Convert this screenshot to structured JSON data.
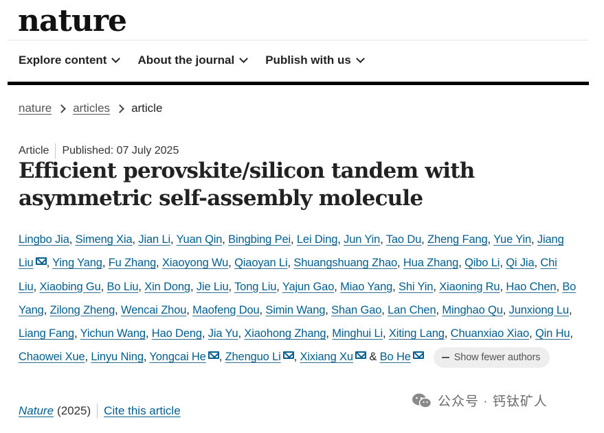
{
  "site": {
    "logo": "nature"
  },
  "nav": {
    "items": [
      {
        "label": "Explore content"
      },
      {
        "label": "About the journal"
      },
      {
        "label": "Publish with us"
      }
    ]
  },
  "breadcrumb": {
    "items": [
      {
        "label": "nature"
      },
      {
        "label": "articles"
      }
    ],
    "current": "article"
  },
  "article": {
    "type": "Article",
    "published": "Published: 07 July 2025",
    "title": "Efficient perovskite/silicon tandem with asymmetric self-assembly molecule",
    "authors": [
      {
        "name": "Lingbo Jia",
        "mail": false
      },
      {
        "name": "Simeng Xia",
        "mail": false
      },
      {
        "name": "Jian Li",
        "mail": false
      },
      {
        "name": "Yuan Qin",
        "mail": false
      },
      {
        "name": "Bingbing Pei",
        "mail": false
      },
      {
        "name": "Lei Ding",
        "mail": false
      },
      {
        "name": "Jun Yin",
        "mail": false
      },
      {
        "name": "Tao Du",
        "mail": false
      },
      {
        "name": "Zheng Fang",
        "mail": false
      },
      {
        "name": "Yue Yin",
        "mail": false
      },
      {
        "name": "Jiang Liu",
        "mail": true
      },
      {
        "name": "Ying Yang",
        "mail": false
      },
      {
        "name": "Fu Zhang",
        "mail": false
      },
      {
        "name": "Xiaoyong Wu",
        "mail": false
      },
      {
        "name": "Qiaoyan Li",
        "mail": false
      },
      {
        "name": "Shuangshuang Zhao",
        "mail": false
      },
      {
        "name": "Hua Zhang",
        "mail": false
      },
      {
        "name": "Qibo Li",
        "mail": false
      },
      {
        "name": "Qi Jia",
        "mail": false
      },
      {
        "name": "Chi Liu",
        "mail": false
      },
      {
        "name": "Xiaobing Gu",
        "mail": false
      },
      {
        "name": "Bo Liu",
        "mail": false
      },
      {
        "name": "Xin Dong",
        "mail": false
      },
      {
        "name": "Jie Liu",
        "mail": false
      },
      {
        "name": "Tong Liu",
        "mail": false
      },
      {
        "name": "Yajun Gao",
        "mail": false
      },
      {
        "name": "Miao Yang",
        "mail": false
      },
      {
        "name": "Shi Yin",
        "mail": false
      },
      {
        "name": "Xiaoning Ru",
        "mail": false
      },
      {
        "name": "Hao Chen",
        "mail": false
      },
      {
        "name": "Bo Yang",
        "mail": false
      },
      {
        "name": "Zilong Zheng",
        "mail": false
      },
      {
        "name": "Wencai Zhou",
        "mail": false
      },
      {
        "name": "Maofeng Dou",
        "mail": false
      },
      {
        "name": "Simin Wang",
        "mail": false
      },
      {
        "name": "Shan Gao",
        "mail": false
      },
      {
        "name": "Lan Chen",
        "mail": false
      },
      {
        "name": "Minghao Qu",
        "mail": false
      },
      {
        "name": "Junxiong Lu",
        "mail": false
      },
      {
        "name": "Liang Fang",
        "mail": false
      },
      {
        "name": "Yichun Wang",
        "mail": false
      },
      {
        "name": "Hao Deng",
        "mail": false
      },
      {
        "name": "Jia Yu",
        "mail": false
      },
      {
        "name": "Xiaohong Zhang",
        "mail": false
      },
      {
        "name": "Minghui Li",
        "mail": false
      },
      {
        "name": "Xiting Lang",
        "mail": false
      },
      {
        "name": "Chuanxiao Xiao",
        "mail": false
      },
      {
        "name": "Qin Hu",
        "mail": false
      },
      {
        "name": "Chaowei Xue",
        "mail": false
      },
      {
        "name": "Linyu Ning",
        "mail": false
      },
      {
        "name": "Yongcai He",
        "mail": true
      },
      {
        "name": "Zhenguo Li",
        "mail": true
      },
      {
        "name": "Xixiang Xu",
        "mail": true
      },
      {
        "name": "Bo He",
        "mail": true
      }
    ],
    "show_fewer_label": "Show fewer authors",
    "journal": "Nature",
    "year": "(2025)",
    "cite_label": "Cite this article"
  },
  "watermark": {
    "text": "公众号 · 钙钛矿人",
    "icon": "wechat-icon"
  },
  "colors": {
    "link": "#025e8d",
    "text": "#222222",
    "rule": "#000000",
    "pill_bg": "#eeeeee"
  }
}
